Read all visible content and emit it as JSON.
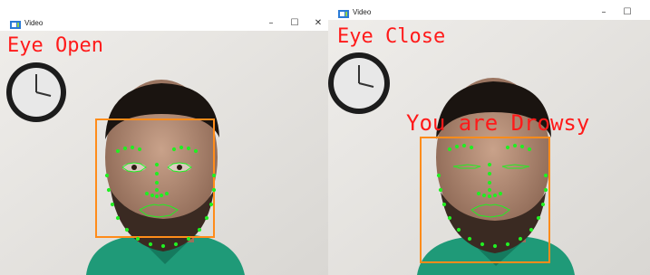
{
  "windows": [
    {
      "title": "Video",
      "state_label": "Eye Open",
      "controls": {
        "minimize": "–",
        "maximize": "☐",
        "close": "✕"
      }
    },
    {
      "title": "Video",
      "state_label": "Eye Close",
      "alert_label": "You are Drowsy",
      "controls": {
        "minimize": "–",
        "maximize": "☐"
      }
    }
  ],
  "colors": {
    "overlay_text": "#ff1a1a",
    "face_box": "#ff8c1a",
    "landmarks": "#22ee22",
    "wall": "#e6e4e0",
    "shirt": "#1f9a78"
  },
  "icons": [
    "video-window-icon",
    "minimize-icon",
    "maximize-icon",
    "close-icon"
  ]
}
